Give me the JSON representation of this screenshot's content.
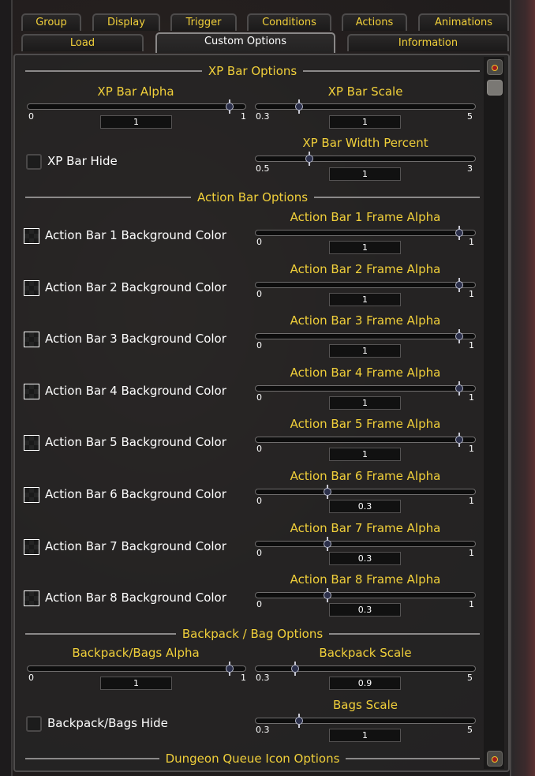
{
  "tabs": {
    "row1": [
      {
        "label": "Group"
      },
      {
        "label": "Display"
      },
      {
        "label": "Trigger"
      },
      {
        "label": "Conditions"
      },
      {
        "label": "Actions"
      },
      {
        "label": "Animations"
      }
    ],
    "row2": [
      {
        "label": "Load"
      },
      {
        "label": "Custom Options",
        "active": true
      },
      {
        "label": "Information"
      }
    ]
  },
  "sections": {
    "xp": "XP Bar Options",
    "action": "Action Bar Options",
    "bags": "Backpack / Bag Options",
    "dungeon": "Dungeon Queue Icon Options"
  },
  "xp": {
    "alpha": {
      "label": "XP Bar Alpha",
      "min": "0",
      "max": "1",
      "value": "1",
      "fraction": 1.0
    },
    "scale": {
      "label": "XP Bar Scale",
      "min": "0.3",
      "max": "5",
      "value": "1",
      "fraction": 0.149
    },
    "width": {
      "label": "XP Bar Width Percent",
      "min": "0.5",
      "max": "3",
      "value": "1",
      "fraction": 0.2
    },
    "hide": {
      "label": "XP Bar Hide",
      "checked": false
    }
  },
  "action_bars": [
    {
      "color_label": "Action Bar 1 Background Color",
      "alpha_label": "Action Bar 1 Frame Alpha",
      "min": "0",
      "max": "1",
      "value": "1",
      "fraction": 1.0
    },
    {
      "color_label": "Action Bar 2 Background Color",
      "alpha_label": "Action Bar 2 Frame Alpha",
      "min": "0",
      "max": "1",
      "value": "1",
      "fraction": 1.0
    },
    {
      "color_label": "Action Bar 3 Background Color",
      "alpha_label": "Action Bar 3 Frame Alpha",
      "min": "0",
      "max": "1",
      "value": "1",
      "fraction": 1.0
    },
    {
      "color_label": "Action Bar 4 Background Color",
      "alpha_label": "Action Bar 4 Frame Alpha",
      "min": "0",
      "max": "1",
      "value": "1",
      "fraction": 1.0
    },
    {
      "color_label": "Action Bar 5 Background Color",
      "alpha_label": "Action Bar 5 Frame Alpha",
      "min": "0",
      "max": "1",
      "value": "1",
      "fraction": 1.0
    },
    {
      "color_label": "Action Bar 6 Background Color",
      "alpha_label": "Action Bar 6 Frame Alpha",
      "min": "0",
      "max": "1",
      "value": "0.3",
      "fraction": 0.3
    },
    {
      "color_label": "Action Bar 7 Background Color",
      "alpha_label": "Action Bar 7 Frame Alpha",
      "min": "0",
      "max": "1",
      "value": "0.3",
      "fraction": 0.3
    },
    {
      "color_label": "Action Bar 8 Background Color",
      "alpha_label": "Action Bar 8 Frame Alpha",
      "min": "0",
      "max": "1",
      "value": "0.3",
      "fraction": 0.3
    }
  ],
  "bags": {
    "alpha": {
      "label": "Backpack/Bags Alpha",
      "min": "0",
      "max": "1",
      "value": "1",
      "fraction": 1.0
    },
    "backpack_scale": {
      "label": "Backpack Scale",
      "min": "0.3",
      "max": "5",
      "value": "0.9",
      "fraction": 0.128
    },
    "bags_scale": {
      "label": "Bags Scale",
      "min": "0.3",
      "max": "5",
      "value": "1",
      "fraction": 0.149
    },
    "hide": {
      "label": "Backpack/Bags Hide",
      "checked": false
    }
  },
  "colors": {
    "accent_gold": "#f0cf3a",
    "text_white": "#ffffff"
  }
}
